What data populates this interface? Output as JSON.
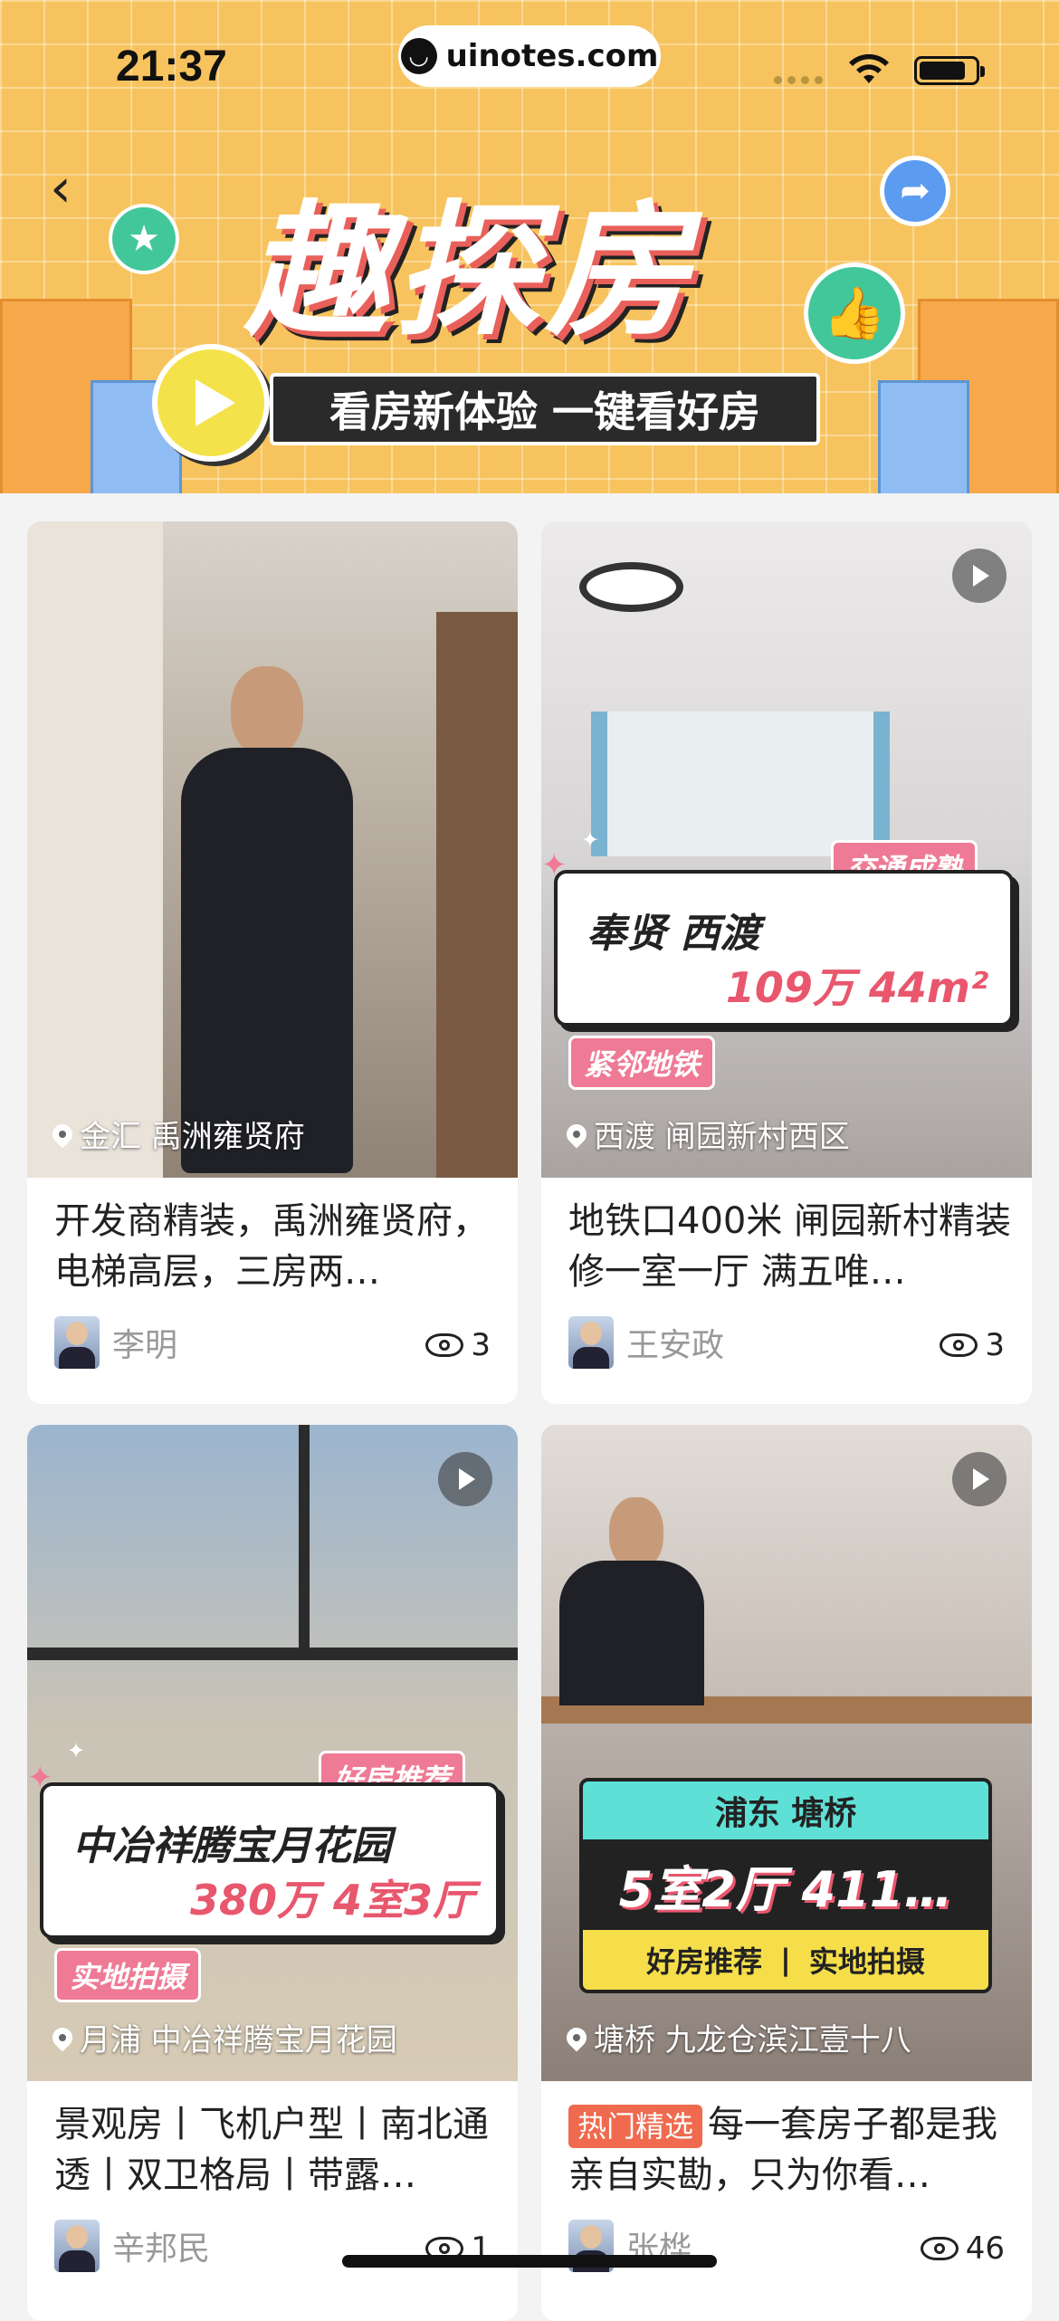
{
  "status": {
    "time": "21:37",
    "url": "uinotes.com"
  },
  "header": {
    "title": "趣探房",
    "slogan": "看房新体验 一键看好房",
    "back_icon": "back-chevron-icon",
    "share_icon": "share-arrow-icon",
    "back_glyph": "‹",
    "share_glyph": "➦",
    "star_glyph": "★",
    "thumb_glyph": "👍"
  },
  "cards": [
    {
      "location": "金汇 禹洲雍贤府",
      "title": "开发商精装，禹洲雍贤府，电梯高层，三房两…",
      "author": "李明",
      "views": "3"
    },
    {
      "location": "西渡 闸园新村西区",
      "title": "地铁口400米 闸园新村精装修一室一厅 满五唯…",
      "author": "王安政",
      "views": "3",
      "overlay": {
        "tag_top": "交通成熟",
        "name": "奉贤 西渡",
        "price": "109万 44m²",
        "tag_bottom": "紧邻地铁"
      }
    },
    {
      "location": "月浦 中冶祥腾宝月花园",
      "title": "景观房丨飞机户型丨南北通透丨双卫格局丨带露…",
      "author": "辛邦民",
      "views": "1",
      "overlay": {
        "tag_top": "好房推荐",
        "name": "中冶祥腾宝月花园",
        "price": "380万 4室3厅",
        "tag_bottom": "实地拍摄"
      }
    },
    {
      "location": "塘桥 九龙仓滨江壹十八",
      "hot_badge": "热门精选",
      "title": "每一套房子都是我亲自实勘，只为你看…",
      "author": "张桦",
      "views": "46",
      "overlay": {
        "area": "浦东 塘桥",
        "layout": "5室2厅 411…",
        "tag_left": "好房推荐",
        "tag_sep": "|",
        "tag_right": "实地拍摄"
      }
    }
  ]
}
